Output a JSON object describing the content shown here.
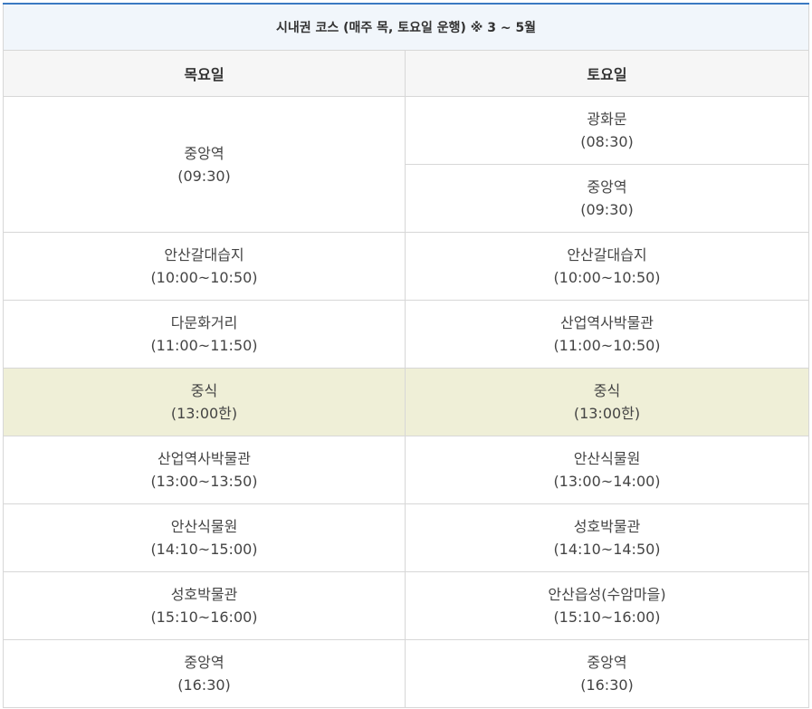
{
  "title": "시내권 코스 (매주 목, 토요일 운행) ※ 3 ~ 5월",
  "columns": [
    "목요일",
    "토요일"
  ],
  "thursday": [
    {
      "place": "중앙역",
      "time": "(09:30)"
    },
    {
      "place": "안산갈대습지",
      "time": "(10:00~10:50)"
    },
    {
      "place": "다문화거리",
      "time": "(11:00~11:50)"
    },
    {
      "place": "중식",
      "time": "(13:00한)"
    },
    {
      "place": "산업역사박물관",
      "time": "(13:00~13:50)"
    },
    {
      "place": "안산식물원",
      "time": "(14:10~15:00)"
    },
    {
      "place": "성호박물관",
      "time": "(15:10~16:00)"
    },
    {
      "place": "중앙역",
      "time": "(16:30)"
    }
  ],
  "saturday": [
    {
      "place": "광화문",
      "time": "(08:30)"
    },
    {
      "place": "중앙역",
      "time": "(09:30)"
    },
    {
      "place": "안산갈대습지",
      "time": "(10:00~10:50)"
    },
    {
      "place": "산업역사박물관",
      "time": "(11:00~10:50)"
    },
    {
      "place": "중식",
      "time": "(13:00한)"
    },
    {
      "place": "안산식물원",
      "time": "(13:00~14:00)"
    },
    {
      "place": "성호박물관",
      "time": "(14:10~14:50)"
    },
    {
      "place": "안산읍성(수암마을)",
      "time": "(15:10~16:00)"
    },
    {
      "place": "중앙역",
      "time": "(16:30)"
    }
  ],
  "colors": {
    "title_bg": "#f1f6fb",
    "header_bg": "#f6f6f6",
    "lunch_bg": "#efefd7",
    "border": "#d7d7d7",
    "accent": "#3b7ac2"
  }
}
